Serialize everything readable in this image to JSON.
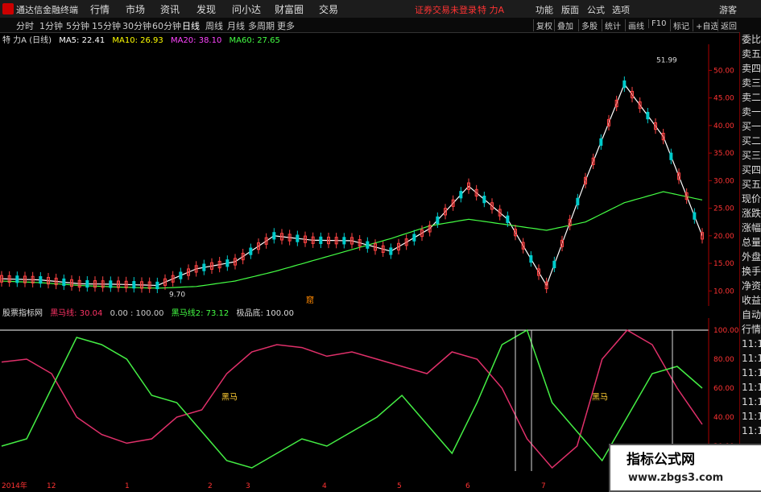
{
  "titlebar": {
    "app_name": "通达信金融终端",
    "menus": [
      "行情",
      "市场",
      "资讯",
      "发现",
      "问小达",
      "财富圈",
      "交易"
    ],
    "login_status": "证券交易未登录",
    "stock": "特 力A",
    "right_menus": [
      "功能",
      "版面",
      "公式",
      "选项"
    ],
    "guest": "游客"
  },
  "toolbar": {
    "periods": [
      "分时",
      "1分钟",
      "5分钟",
      "15分钟",
      "30分钟",
      "60分钟",
      "日线",
      "周线",
      "月线",
      "多周期",
      "更多"
    ],
    "active": "日线",
    "right_buttons": [
      "复权",
      "叠加",
      "多股",
      "统计",
      "画线",
      "F10",
      "标记",
      "+自选",
      "返回"
    ]
  },
  "main_chart": {
    "title": "特 力A (日线)",
    "ma": [
      {
        "label": "MA5: 22.41",
        "color": "#ffffff"
      },
      {
        "label": "MA10: 26.93",
        "color": "#ffff00"
      },
      {
        "label": "MA20: 38.10",
        "color": "#ff44ff"
      },
      {
        "label": "MA60: 27.65",
        "color": "#44ff44"
      }
    ],
    "high_label": "51.99",
    "low_label": "9.70",
    "marker": "窟",
    "price_ticks": [
      "50.00",
      "45.00",
      "40.00",
      "35.00",
      "30.00",
      "25.00",
      "20.00",
      "15.00",
      "10.00"
    ]
  },
  "sidebar": {
    "items": [
      "委比",
      "卖五",
      "卖四",
      "卖三",
      "卖二",
      "卖一",
      "买一",
      "买二",
      "买三",
      "买四",
      "买五",
      "现价",
      "涨跌",
      "涨幅",
      "总量",
      "外盘",
      "换手",
      "净资",
      "收益",
      "自动",
      "行情",
      "11:1",
      "11:1",
      "11:1",
      "11:1",
      "11:1",
      "11:1",
      "11:1"
    ]
  },
  "indicator": {
    "name": "股票指标网",
    "line1": "黑马线: 30.04",
    "values": "0.00 : 100.00",
    "line2": "黑马线2: 73.12",
    "bottom": "极品底: 100.00",
    "tag": "黑马",
    "ticks": [
      "100.00",
      "80.00",
      "60.00",
      "40.00",
      "20.00"
    ]
  },
  "time_axis": [
    "2014年",
    "12",
    "1",
    "2",
    "3",
    "4",
    "5",
    "6",
    "7"
  ],
  "chart_data": {
    "type": "line",
    "title": "",
    "ylim": [
      8,
      54
    ],
    "series": [
      {
        "name": "MA5",
        "values": [
          12.2,
          12.0,
          11.3,
          11.2,
          11.0,
          14.0,
          15.3,
          20.0,
          19.2,
          19.1,
          17.2,
          21.3,
          29.0,
          23.0,
          11.0,
          30.0,
          47.5,
          38.0,
          20.0
        ]
      },
      {
        "name": "MA60",
        "values": [
          11.8,
          11.5,
          11.0,
          10.7,
          10.5,
          10.8,
          11.8,
          13.5,
          15.5,
          17.5,
          19.5,
          21.8,
          23.0,
          22.0,
          21.0,
          22.5,
          26.0,
          28.0,
          26.5
        ]
      }
    ]
  },
  "watermark": {
    "text": "指标公式网",
    "url": "www.zbgs3.com"
  }
}
